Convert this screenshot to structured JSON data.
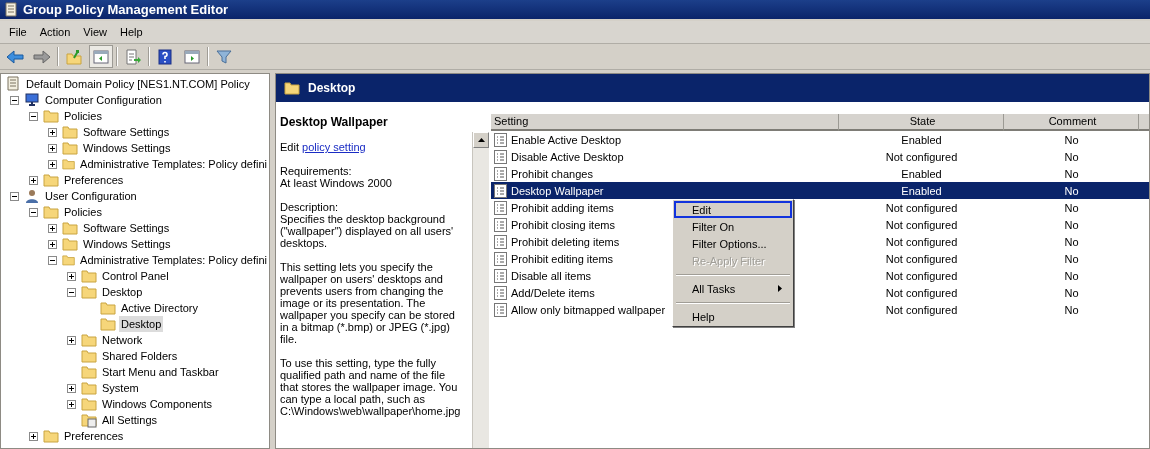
{
  "window": {
    "title": "Group Policy Management Editor"
  },
  "menu": [
    "File",
    "Action",
    "View",
    "Help"
  ],
  "toolbar": [
    {
      "kind": "back",
      "pressed": false
    },
    {
      "kind": "forward",
      "pressed": false
    },
    {
      "kind": "separator"
    },
    {
      "kind": "up",
      "pressed": false
    },
    {
      "kind": "tree",
      "pressed": true
    },
    {
      "kind": "separator"
    },
    {
      "kind": "export",
      "pressed": false
    },
    {
      "kind": "separator"
    },
    {
      "kind": "help",
      "pressed": false
    },
    {
      "kind": "pane",
      "pressed": false
    },
    {
      "kind": "separator"
    },
    {
      "kind": "filter",
      "pressed": false
    }
  ],
  "tree": [
    {
      "label": "Default Domain Policy [NES1.NT.COM] Policy",
      "kind": "policy",
      "selected": false,
      "children": [
        {
          "label": "Computer Configuration",
          "kind": "computer",
          "expanded": true,
          "selected": false,
          "children": [
            {
              "label": "Policies",
              "kind": "folder",
              "expanded": true,
              "selected": false,
              "children": [
                {
                  "label": "Software Settings",
                  "kind": "folder",
                  "expanded": false,
                  "selected": false
                },
                {
                  "label": "Windows Settings",
                  "kind": "folder",
                  "expanded": false,
                  "selected": false
                },
                {
                  "label": "Administrative Templates: Policy defini",
                  "kind": "folder",
                  "expanded": false,
                  "selected": false
                }
              ]
            },
            {
              "label": "Preferences",
              "kind": "folder",
              "expanded": false,
              "selected": false
            }
          ]
        },
        {
          "label": "User Configuration",
          "kind": "user",
          "expanded": true,
          "selected": false,
          "children": [
            {
              "label": "Policies",
              "kind": "folder",
              "expanded": true,
              "selected": false,
              "children": [
                {
                  "label": "Software Settings",
                  "kind": "folder",
                  "expanded": false,
                  "selected": false
                },
                {
                  "label": "Windows Settings",
                  "kind": "folder",
                  "expanded": false,
                  "selected": false
                },
                {
                  "label": "Administrative Templates: Policy defini",
                  "kind": "folder",
                  "expanded": true,
                  "selected": false,
                  "children": [
                    {
                      "label": "Control Panel",
                      "kind": "folder",
                      "expanded": false,
                      "selected": false
                    },
                    {
                      "label": "Desktop",
                      "kind": "folder",
                      "expanded": true,
                      "selected": false,
                      "children": [
                        {
                          "label": "Active Directory",
                          "kind": "folder",
                          "selected": false
                        },
                        {
                          "label": "Desktop",
                          "kind": "folder",
                          "selected": true
                        }
                      ]
                    },
                    {
                      "label": "Network",
                      "kind": "folder",
                      "expanded": false,
                      "selected": false
                    },
                    {
                      "label": "Shared Folders",
                      "kind": "folder",
                      "selected": false
                    },
                    {
                      "label": "Start Menu and Taskbar",
                      "kind": "folder",
                      "selected": false
                    },
                    {
                      "label": "System",
                      "kind": "folder",
                      "expanded": false,
                      "selected": false
                    },
                    {
                      "label": "Windows Components",
                      "kind": "folder",
                      "expanded": false,
                      "selected": false
                    },
                    {
                      "label": "All Settings",
                      "kind": "settings",
                      "selected": false
                    }
                  ]
                }
              ]
            },
            {
              "label": "Preferences",
              "kind": "folder",
              "expanded": false,
              "selected": false
            }
          ]
        }
      ]
    }
  ],
  "pane": {
    "title": "Desktop"
  },
  "description": {
    "heading": "Desktop Wallpaper",
    "edit_prefix": "Edit",
    "edit_link": "policy setting",
    "paragraphs": [
      "Requirements:\nAt least Windows 2000",
      "Description:\nSpecifies the desktop background (\"wallpaper\") displayed on all users' desktops.",
      "This setting lets you specify the wallpaper on users' desktops and prevents users from changing the image or its presentation. The wallpaper you specify can be stored in a bitmap (*.bmp) or JPEG (*.jpg) file.",
      "To use this setting, type the fully qualified path and name of the file that stores the wallpaper image. You can type a local path, such as C:\\Windows\\web\\wallpaper\\home.jpg"
    ]
  },
  "table": {
    "columns": [
      "Setting",
      "State",
      "Comment"
    ],
    "rows": [
      {
        "setting": "Enable Active Desktop",
        "state": "Enabled",
        "comment": "No",
        "selected": false
      },
      {
        "setting": "Disable Active Desktop",
        "state": "Not configured",
        "comment": "No",
        "selected": false
      },
      {
        "setting": "Prohibit changes",
        "state": "Enabled",
        "comment": "No",
        "selected": false
      },
      {
        "setting": "Desktop Wallpaper",
        "state": "Enabled",
        "comment": "No",
        "selected": true
      },
      {
        "setting": "Prohibit adding items",
        "state": "Not configured",
        "comment": "No",
        "selected": false
      },
      {
        "setting": "Prohibit closing items",
        "state": "Not configured",
        "comment": "No",
        "selected": false
      },
      {
        "setting": "Prohibit deleting items",
        "state": "Not configured",
        "comment": "No",
        "selected": false
      },
      {
        "setting": "Prohibit editing items",
        "state": "Not configured",
        "comment": "No",
        "selected": false
      },
      {
        "setting": "Disable all items",
        "state": "Not configured",
        "comment": "No",
        "selected": false
      },
      {
        "setting": "Add/Delete items",
        "state": "Not configured",
        "comment": "No",
        "selected": false
      },
      {
        "setting": "Allow only bitmapped wallpaper",
        "state": "Not configured",
        "comment": "No",
        "selected": false
      }
    ]
  },
  "context_menu": [
    {
      "kind": "item",
      "label": "Edit",
      "selected": true,
      "disabled": false
    },
    {
      "kind": "item",
      "label": "Filter On",
      "selected": false,
      "disabled": false
    },
    {
      "kind": "item",
      "label": "Filter Options...",
      "selected": false,
      "disabled": false
    },
    {
      "kind": "item",
      "label": "Re-Apply Filter",
      "selected": false,
      "disabled": true
    },
    {
      "kind": "separator"
    },
    {
      "kind": "submenu",
      "label": "All Tasks",
      "selected": false,
      "disabled": false
    },
    {
      "kind": "separator"
    },
    {
      "kind": "item",
      "label": "Help",
      "selected": false,
      "disabled": false
    }
  ]
}
